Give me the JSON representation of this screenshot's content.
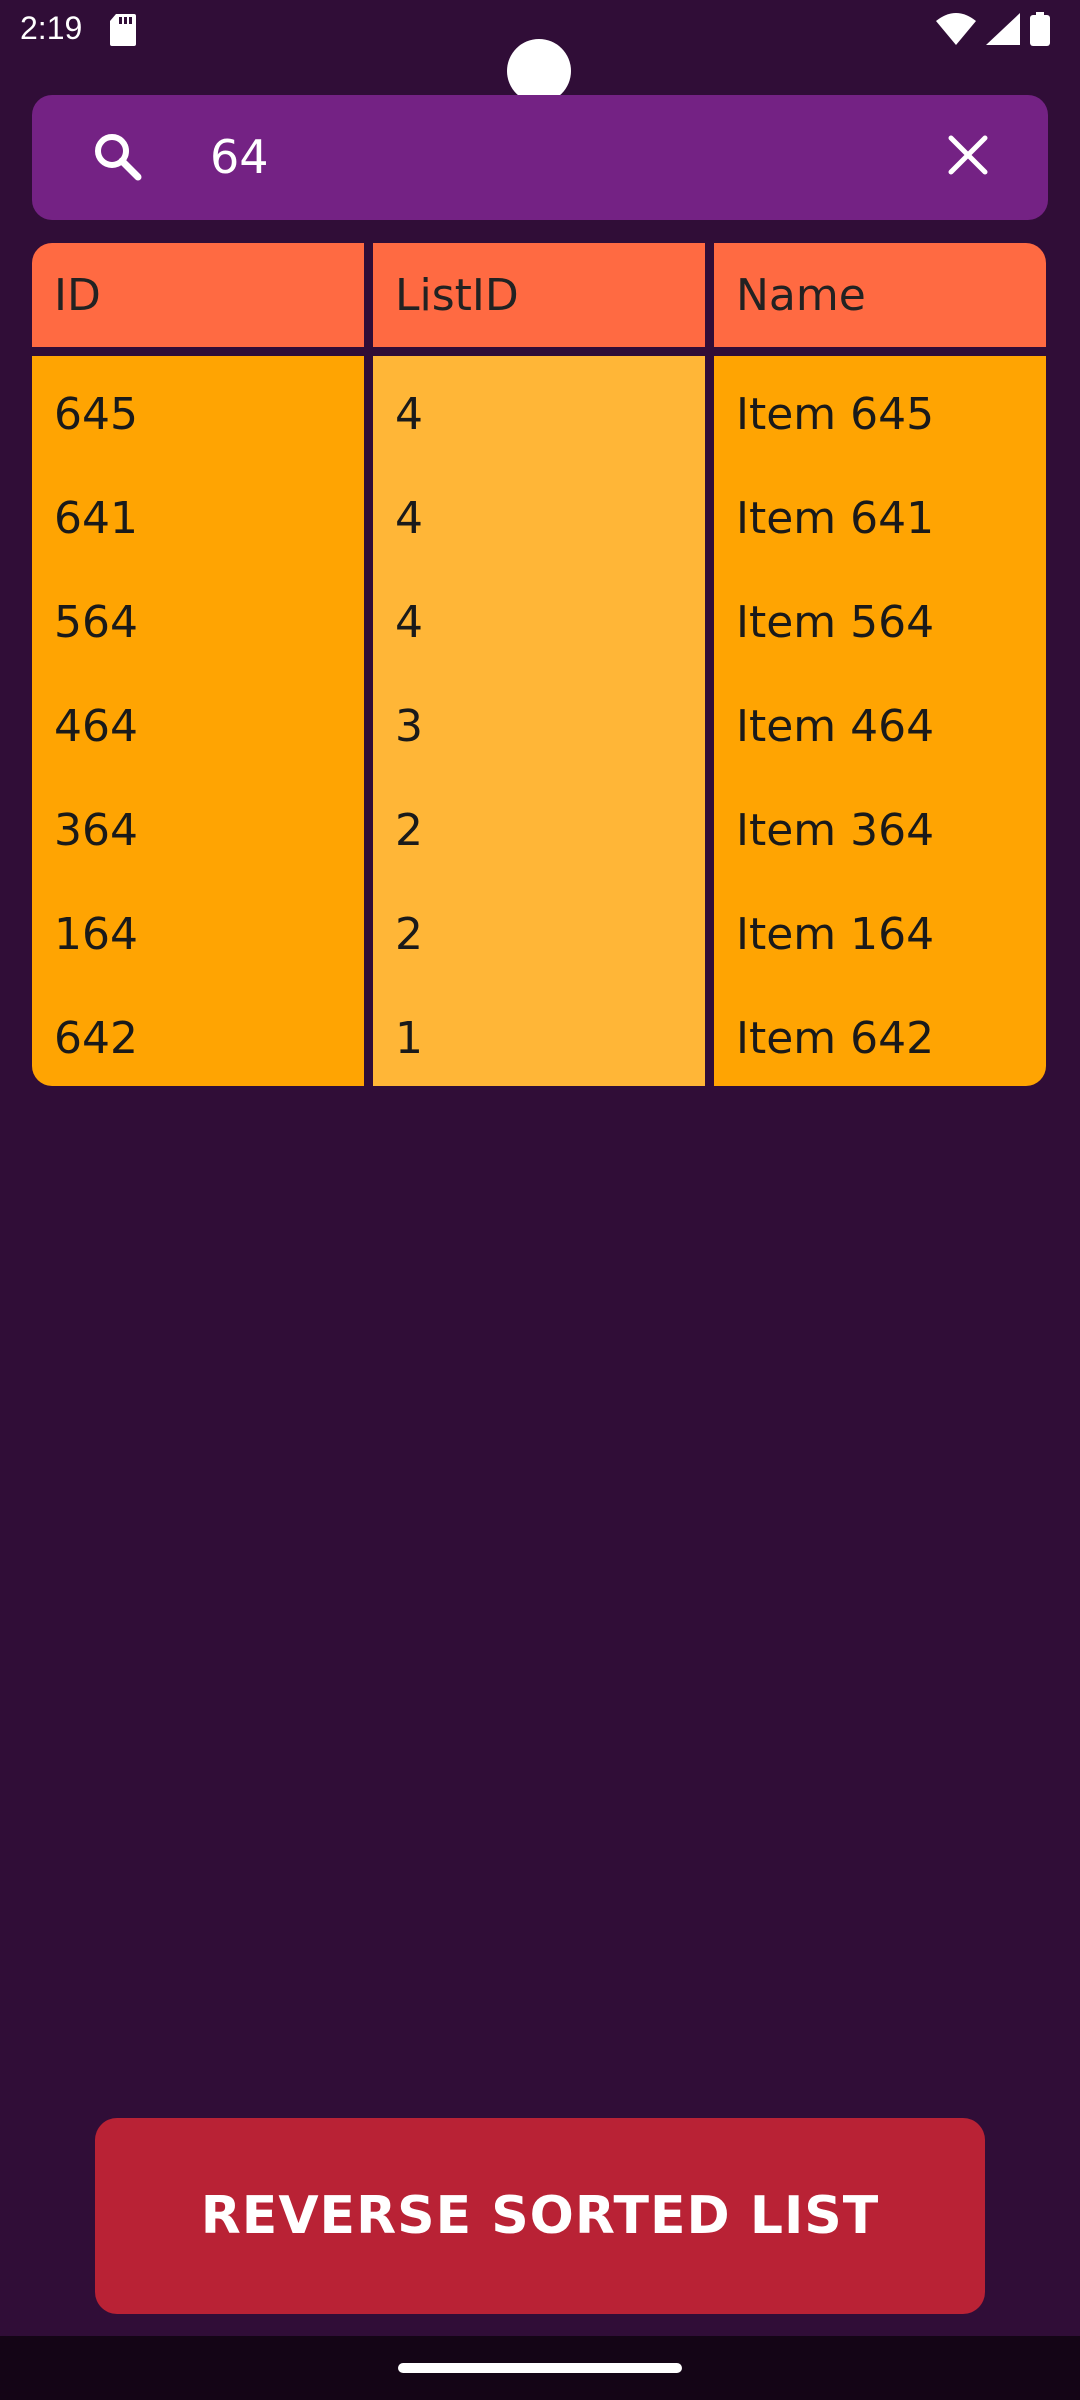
{
  "status_bar": {
    "time": "2:19",
    "icons": [
      "sd-card-icon",
      "wifi-icon",
      "cell-signal-icon",
      "battery-icon"
    ]
  },
  "search": {
    "value": "64",
    "icon": "search-icon",
    "clear_icon": "close-icon"
  },
  "table": {
    "headers": [
      "ID",
      "ListID",
      "Name"
    ],
    "rows": [
      [
        "645",
        "4",
        "Item 645"
      ],
      [
        "641",
        "4",
        "Item 641"
      ],
      [
        "564",
        "4",
        "Item 564"
      ],
      [
        "464",
        "3",
        "Item 464"
      ],
      [
        "364",
        "2",
        "Item 364"
      ],
      [
        "164",
        "2",
        "Item 164"
      ],
      [
        "642",
        "1",
        "Item 642"
      ]
    ]
  },
  "actions": {
    "reverse_label": "REVERSE SORTED LIST"
  },
  "colors": {
    "background": "#300d37",
    "search_bar": "#742284",
    "header": "#ff6a42",
    "cell_primary": "#ffa402",
    "cell_secondary": "#ffb637",
    "button": "#b92235"
  }
}
